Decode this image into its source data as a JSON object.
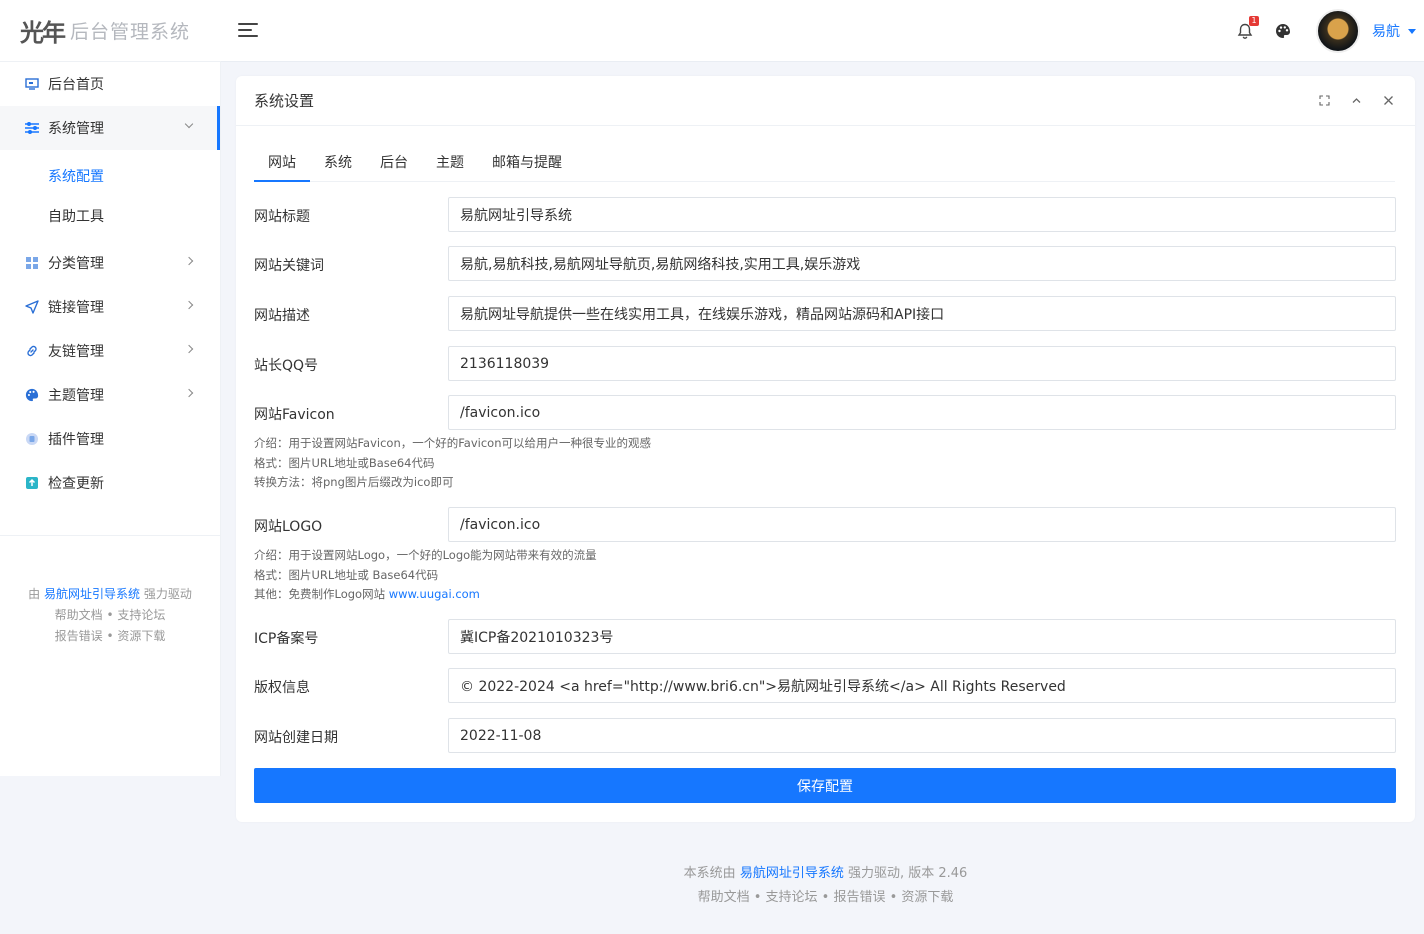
{
  "header": {
    "logo_mark": "光年",
    "logo_text": "后台管理系统",
    "notification_count": "1",
    "username": "易航"
  },
  "sidebar": {
    "items": [
      {
        "label": "后台首页",
        "icon": "monitor-icon"
      },
      {
        "label": "系统管理",
        "icon": "sliders-icon",
        "expanded": true
      },
      {
        "label": "分类管理",
        "icon": "grid-icon"
      },
      {
        "label": "链接管理",
        "icon": "send-icon"
      },
      {
        "label": "友链管理",
        "icon": "link-icon"
      },
      {
        "label": "主题管理",
        "icon": "palette-icon"
      },
      {
        "label": "插件管理",
        "icon": "plugin-icon"
      },
      {
        "label": "检查更新",
        "icon": "upload-icon"
      }
    ],
    "sub_items": [
      {
        "label": "系统配置",
        "active": true
      },
      {
        "label": "自助工具",
        "active": false
      }
    ],
    "footer": {
      "prefix": "由",
      "brand": "易航网址引导系统",
      "suffix": "强力驱动",
      "links1": "帮助文档 • 支持论坛",
      "links2": "报告错误 • 资源下载"
    }
  },
  "card": {
    "title": "系统设置",
    "tabs": [
      "网站",
      "系统",
      "后台",
      "主题",
      "邮箱与提醒"
    ],
    "active_tab": "网站",
    "fields": [
      {
        "label": "网站标题",
        "value": "易航网址引导系统"
      },
      {
        "label": "网站关键词",
        "value": "易航,易航科技,易航网址导航页,易航网络科技,实用工具,娱乐游戏"
      },
      {
        "label": "网站描述",
        "value": "易航网址导航提供一些在线实用工具，在线娱乐游戏，精品网站源码和API接口"
      },
      {
        "label": "站长QQ号",
        "value": "2136118039"
      },
      {
        "label": "网站Favicon",
        "value": "/favicon.ico"
      },
      {
        "label": "网站LOGO",
        "value": "/favicon.ico"
      },
      {
        "label": "ICP备案号",
        "value": "冀ICP备2021010323号"
      },
      {
        "label": "版权信息",
        "value": "© 2022-2024 <a href=\"http://www.bri6.cn\">易航网址引导系统</a> All Rights Reserved"
      },
      {
        "label": "网站创建日期",
        "value": "2022-11-08"
      }
    ],
    "favicon_help": [
      "介绍：用于设置网站Favicon，一个好的Favicon可以给用户一种很专业的观感",
      "格式：图片URL地址或Base64代码",
      "转换方法：将png图片后缀改为ico即可"
    ],
    "logo_help": [
      "介绍：用于设置网站Logo，一个好的Logo能为网站带来有效的流量",
      "格式：图片URL地址或 Base64代码",
      "其他：免费制作Logo网站",
      "www.uugai.com"
    ],
    "save_label": "保存配置"
  },
  "footer": {
    "prefix": "本系统由",
    "brand": "易航网址引导系统",
    "suffix": "强力驱动, 版本 2.46",
    "links": "帮助文档 • 支持论坛 • 报告错误 • 资源下载"
  },
  "colors": {
    "accent": "#1677ff",
    "background": "#f3f5fa",
    "badge": "#e53935"
  }
}
